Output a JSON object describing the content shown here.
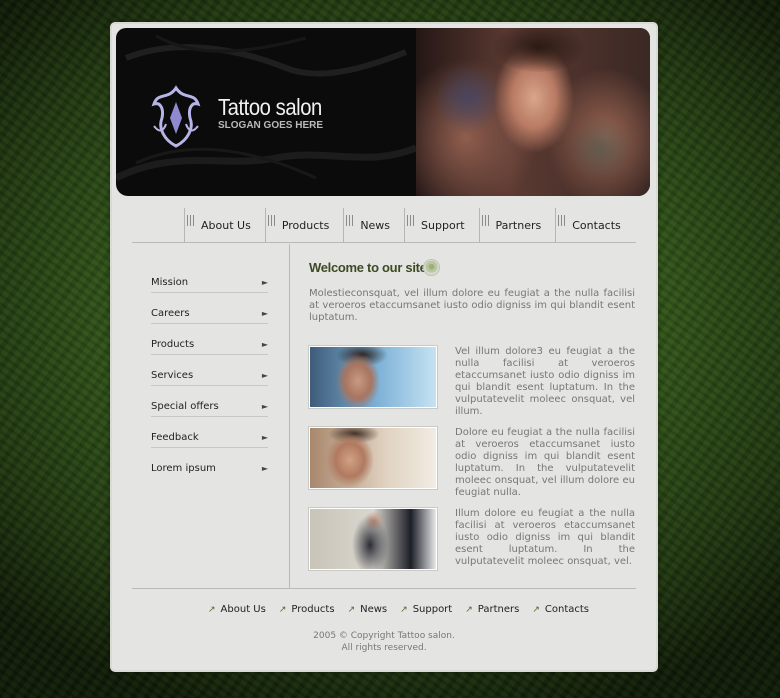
{
  "header": {
    "title": "Tattoo salon",
    "slogan": "SLOGAN GOES HERE"
  },
  "nav": [
    {
      "label": "About Us"
    },
    {
      "label": "Products"
    },
    {
      "label": "News"
    },
    {
      "label": "Support"
    },
    {
      "label": "Partners"
    },
    {
      "label": "Contacts"
    }
  ],
  "sidebar": [
    {
      "label": "Mission"
    },
    {
      "label": "Careers"
    },
    {
      "label": "Products"
    },
    {
      "label": "Services"
    },
    {
      "label": "Special offers"
    },
    {
      "label": "Feedback"
    },
    {
      "label": "Lorem ipsum"
    }
  ],
  "main": {
    "welcome": "Welcome to our site",
    "intro": "Molestieconsquat, vel illum dolore eu feugiat a the nulla facilisi at veroeros etaccumsanet iusto odio digniss im qui blandit esent luptatum.",
    "items": [
      {
        "text": "Vel illum dolore3 eu feugiat a the nulla facilisi at veroeros etaccumsanet iusto odio digniss im qui blandit esent luptatum. In the vulputatevelit moleec onsquat, vel illum."
      },
      {
        "text": "Dolore eu feugiat a the nulla facilisi at veroeros etaccumsanet iusto odio digniss im qui blandit esent luptatum. In the vulputatevelit moleec onsquat, vel illum dolore eu feugiat nulla."
      },
      {
        "text": "Illum dolore eu feugiat a the nulla facilisi at veroeros etaccumsanet iusto odio digniss im qui blandit esent luptatum. In the vulputatevelit moleec onsquat, vel."
      }
    ]
  },
  "footer": {
    "links": [
      {
        "label": "About Us"
      },
      {
        "label": "Products"
      },
      {
        "label": "News"
      },
      {
        "label": "Support"
      },
      {
        "label": "Partners"
      },
      {
        "label": "Contacts"
      }
    ],
    "copyright_line1": "2005 © Copyright Tattoo salon.",
    "copyright_line2": "All rights reserved."
  },
  "colors": {
    "background": "#345a1c",
    "panel": "#e4e4e2",
    "heading": "#3d4a22"
  }
}
